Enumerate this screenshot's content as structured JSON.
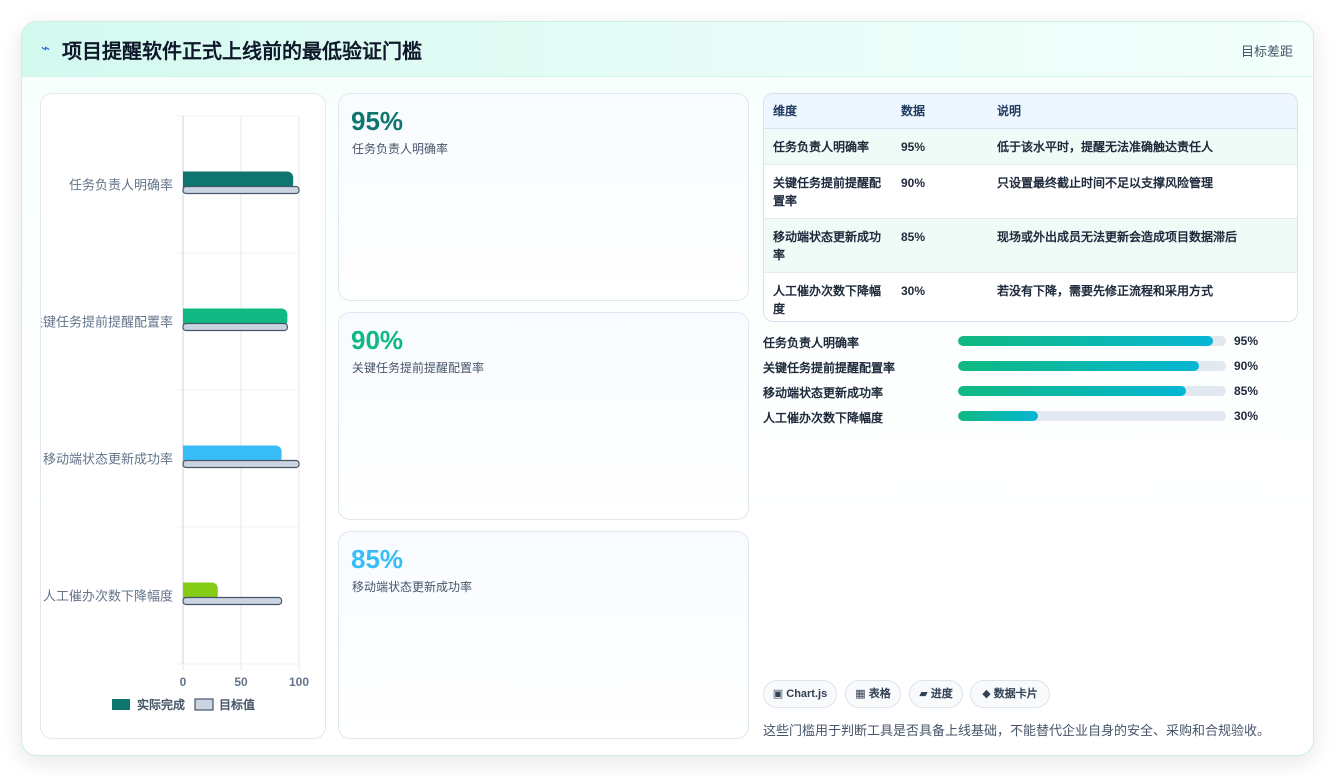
{
  "header": {
    "icon": "bolt-icon",
    "title": "项目提醒软件正式上线前的最低验证门槛",
    "right_label": "目标差距"
  },
  "chart_data": {
    "type": "bar",
    "orientation": "horizontal",
    "categories": [
      "任务负责人明确率",
      "关键任务提前提醒配置率",
      "移动端状态更新成功率",
      "人工催办次数下降幅度"
    ],
    "series": [
      {
        "name": "实际完成",
        "values": [
          95,
          90,
          85,
          30
        ],
        "colors": [
          "#0f766e",
          "#10b981",
          "#38bdf8",
          "#84cc16"
        ]
      },
      {
        "name": "目标值",
        "values": [
          100,
          90,
          100,
          85
        ],
        "color": "#cbd5e1"
      }
    ],
    "x_ticks": [
      0,
      50,
      100
    ],
    "xlim": [
      0,
      100
    ],
    "grid": true,
    "legend_position": "bottom"
  },
  "kpis": [
    {
      "value": "95%",
      "label": "任务负责人明确率",
      "color": "#0f766e"
    },
    {
      "value": "90%",
      "label": "关键任务提前提醒配置率",
      "color": "#10b981"
    },
    {
      "value": "85%",
      "label": "移动端状态更新成功率",
      "color": "#38bdf8"
    }
  ],
  "table": {
    "headers": [
      "维度",
      "数据",
      "说明"
    ],
    "rows": [
      [
        "任务负责人明确率",
        "95%",
        "低于该水平时，提醒无法准确触达责任人"
      ],
      [
        "关键任务提前提醒配置率",
        "90%",
        "只设置最终截止时间不足以支撑风险管理"
      ],
      [
        "移动端状态更新成功率",
        "85%",
        "现场或外出成员无法更新会造成项目数据滞后"
      ],
      [
        "人工催办次数下降幅度",
        "30%",
        "若没有下降，需要先修正流程和采用方式"
      ]
    ]
  },
  "progress": [
    {
      "label": "任务负责人明确率",
      "value": 95,
      "display": "95%"
    },
    {
      "label": "关键任务提前提醒配置率",
      "value": 90,
      "display": "90%"
    },
    {
      "label": "移动端状态更新成功率",
      "value": 85,
      "display": "85%"
    },
    {
      "label": "人工催办次数下降幅度",
      "value": 30,
      "display": "30%"
    }
  ],
  "chips": [
    "▣ Chart.js",
    "▦ 表格",
    "▰ 进度",
    "◆ 数据卡片"
  ],
  "footnote": "这些门槛用于判断工具是否具备上线基础，不能替代企业自身的安全、采购和合规验收。"
}
